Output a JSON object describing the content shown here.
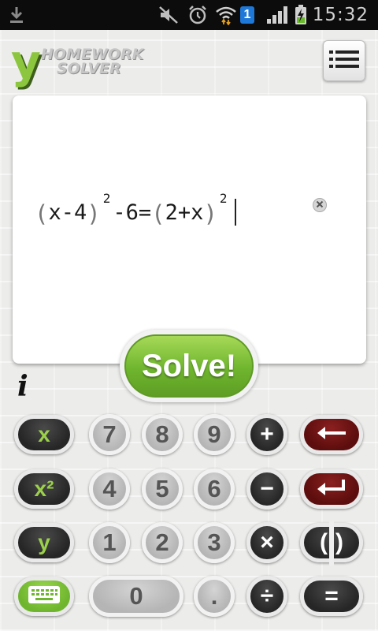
{
  "status_bar": {
    "time": "15:32",
    "notification_badge": "1",
    "icons": [
      "download-icon",
      "mute-icon",
      "alarm-icon",
      "wifi-icon",
      "badge-icon",
      "signal-icon",
      "battery-charging-icon"
    ]
  },
  "header": {
    "logo_letter": "y",
    "logo_line1": "HOMEWORK",
    "logo_line2": "SOLVER",
    "menu_icon": "menu-icon"
  },
  "equation": {
    "tokens": [
      "(",
      "x",
      "-",
      "4",
      ")",
      "2",
      "-",
      "6",
      "=",
      "(",
      "2",
      "+",
      "x",
      ")",
      "2"
    ]
  },
  "solve": {
    "label": "Solve!"
  },
  "info": {
    "label": "i"
  },
  "keypad": {
    "row1": {
      "var": "x",
      "d1": "7",
      "d2": "8",
      "d3": "9",
      "op": "+",
      "action": "backspace"
    },
    "row2": {
      "var": "x²",
      "d1": "4",
      "d2": "5",
      "d3": "6",
      "op": "−",
      "action": "enter"
    },
    "row3": {
      "var": "y",
      "d1": "1",
      "d2": "2",
      "d3": "3",
      "op": "×",
      "action_left": "(",
      "action_right": ")"
    },
    "row4": {
      "action": "keyboard",
      "d0": "0",
      "dot": ".",
      "op": "÷",
      "eq": "="
    }
  },
  "colors": {
    "accent_green": "#8cc63f",
    "key_dark": "#2e2e2e",
    "key_grey": "#bdbdbd",
    "key_red": "#6b1515"
  }
}
